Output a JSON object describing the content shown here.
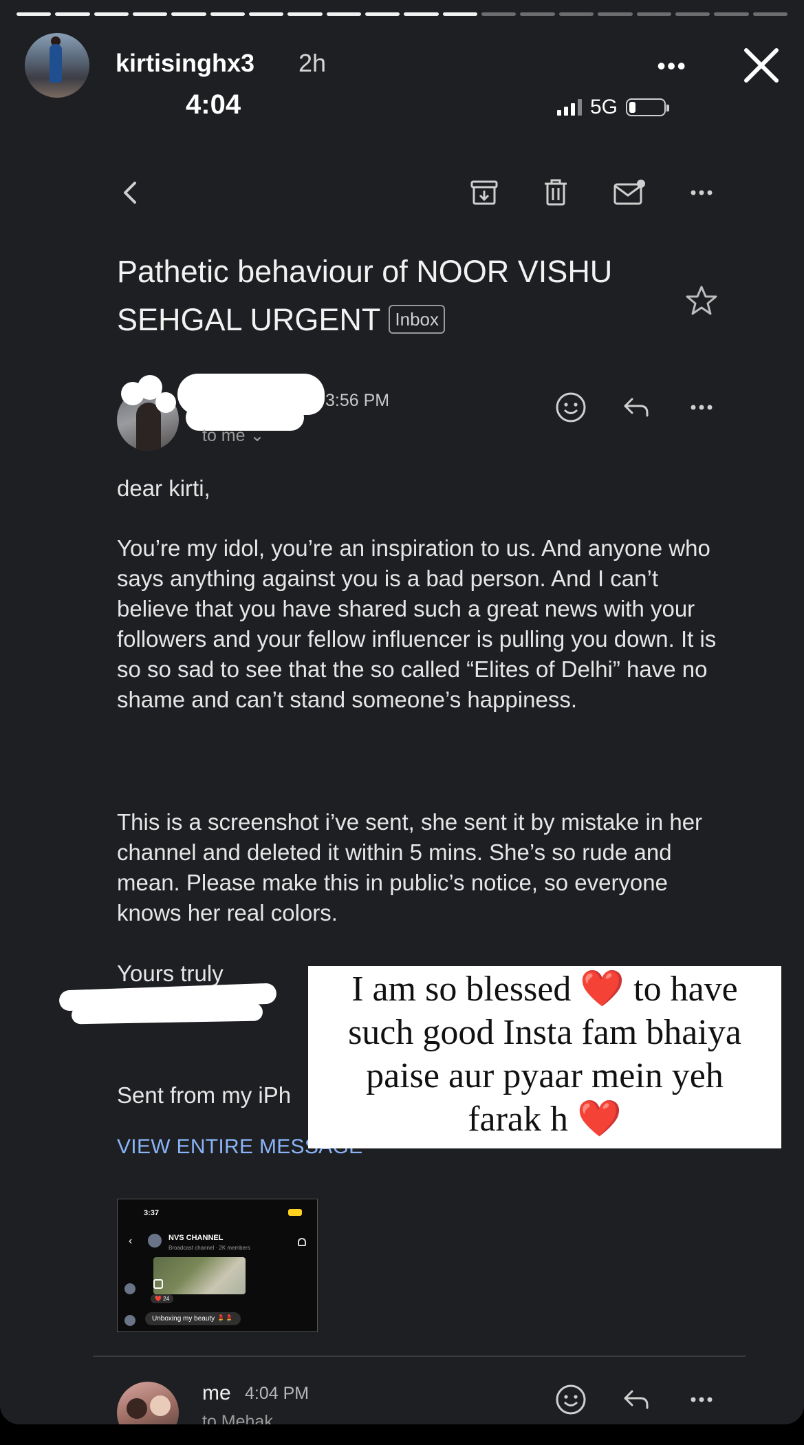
{
  "story": {
    "username": "kirtisinghx3",
    "age": "2h",
    "more_label": "•••",
    "progress": {
      "segments": 20,
      "completed": 12
    }
  },
  "status_bar": {
    "time": "4:04",
    "network": "5G"
  },
  "toolbar": {
    "icons": [
      "back-arrow-icon",
      "archive-icon",
      "trash-icon",
      "mark-unread-icon",
      "more-icon"
    ]
  },
  "email": {
    "subject": "Pathetic behaviour of NOOR VISHU SEHGAL URGENT",
    "label_chip": "Inbox",
    "sent_time": "3:56 PM",
    "to_label": "to me ⌄",
    "greeting": "dear kirti,",
    "paragraph_1": "You’re my idol, you’re an inspiration to us. And anyone who says anything against you is a bad person. And I can’t believe that you have shared such a great news with your followers and your fellow influencer is pulling you down. It is so so sad to see that the so called “Elites of Delhi” have no shame and can’t stand someone’s happiness.",
    "paragraph_2": "This is a screenshot i’ve sent, she sent it by mistake in her channel and deleted it within 5 mins. She’s so rude and mean. Please make this in public’s notice, so everyone knows her real colors.",
    "closing": "Yours truly",
    "sent_from": "Sent from my iPh",
    "view_entire": "VIEW ENTIRE MESSAGE"
  },
  "attachment": {
    "time": "3:37",
    "channel_name": "NVS CHANNEL",
    "channel_sub": "Broadcast channel · 2K members",
    "reaction": "❤️ 24",
    "bubble": "Unboxing my beauty 💄💄"
  },
  "sticker": {
    "line1_a": "I am so blessed",
    "line1_heart": "❤️",
    "line1_b": "to have",
    "line2": "such good Insta fam bhaiya",
    "line3": "paise aur pyaar mein yeh",
    "line4_a": "farak h",
    "line4_heart": "❤️"
  },
  "reply": {
    "name": "me",
    "time": "4:04 PM",
    "to_label": "to Mehak"
  },
  "colors": {
    "background": "#1e1f22",
    "text": "#e6e6e6",
    "link": "#8ab4f8",
    "heart": "#e0232e"
  }
}
